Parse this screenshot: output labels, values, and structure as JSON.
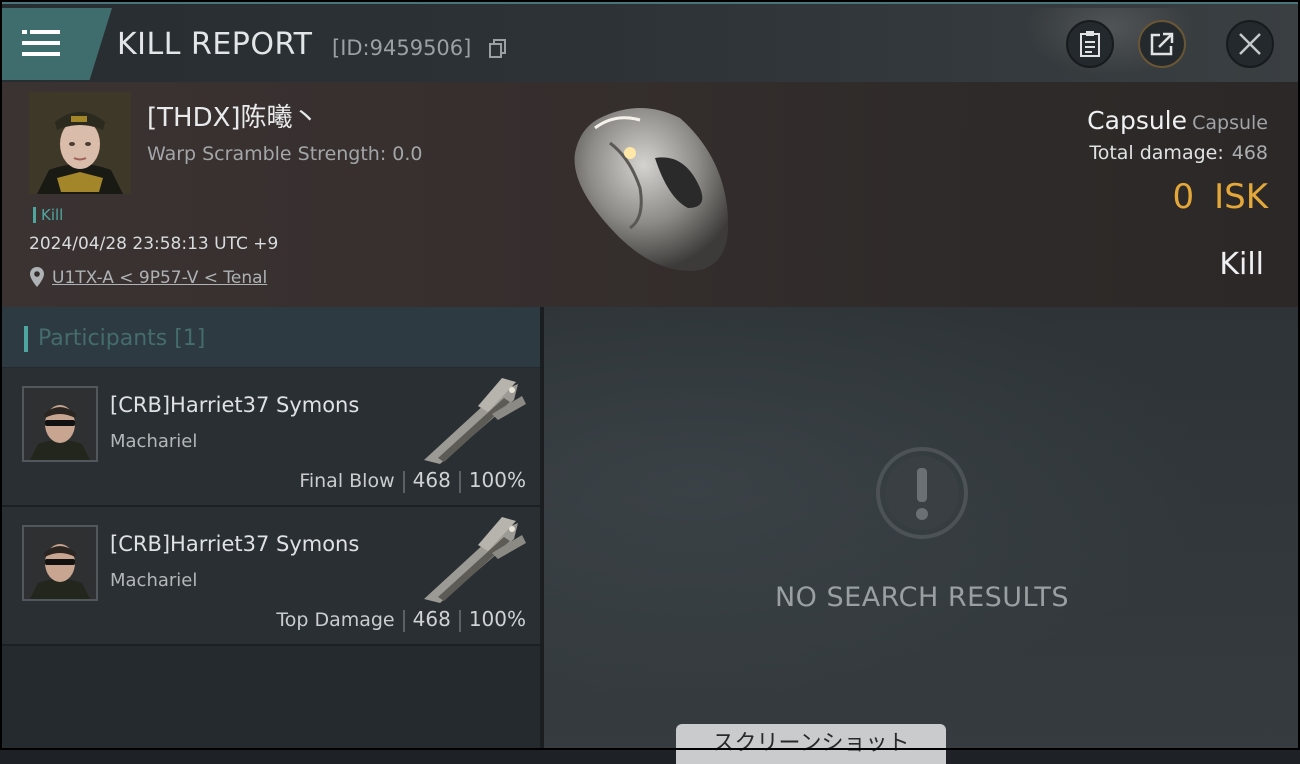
{
  "header": {
    "title": "KILL REPORT",
    "kill_id": "[ID:9459506]"
  },
  "victim": {
    "name": "[THDX]陈曦丶",
    "warp_scramble": "Warp Scramble Strength: 0.0",
    "kill_tag": "Kill",
    "timestamp": "2024/04/28 23:58:13 UTC +9",
    "location": "U1TX-A < 9P57-V < Tenal",
    "ship_type": "Capsule",
    "ship_class": "Capsule",
    "total_damage_label": "Total damage:",
    "total_damage": "468",
    "isk_value": "0",
    "isk_unit": "ISK",
    "result": "Kill"
  },
  "participants_panel": {
    "header": "Participants [1]"
  },
  "participants": [
    {
      "name": "[CRB]Harriet37 Symons",
      "ship": "Machariel",
      "role": "Final Blow",
      "damage": "468",
      "percent": "100%"
    },
    {
      "name": "[CRB]Harriet37 Symons",
      "ship": "Machariel",
      "role": "Top Damage",
      "damage": "468",
      "percent": "100%"
    }
  ],
  "empty_state": {
    "text": "NO SEARCH RESULTS"
  },
  "screenshot_button": {
    "label": "スクリーンショット"
  },
  "colors": {
    "accent_teal": "#4fa6a1",
    "isk_gold": "#e4a83a",
    "menu_button": "#3f6d6d"
  },
  "icons": [
    "menu-icon",
    "copy-icon",
    "clipboard-icon",
    "share-icon",
    "close-icon",
    "location-pin-icon",
    "exclamation-icon"
  ]
}
